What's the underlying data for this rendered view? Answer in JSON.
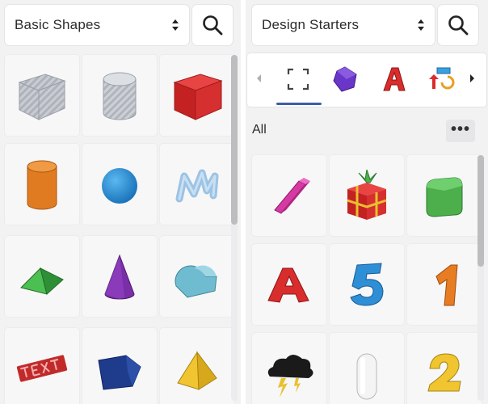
{
  "left_panel": {
    "library_select": {
      "selected": "Basic Shapes"
    },
    "search_icon": "search-icon",
    "shapes": [
      {
        "name": "box-hole",
        "color": "#b8bcc4"
      },
      {
        "name": "cylinder-hole",
        "color": "#b8bcc4"
      },
      {
        "name": "box",
        "color": "#d92d2d"
      },
      {
        "name": "cylinder",
        "color": "#e07b22"
      },
      {
        "name": "sphere",
        "color": "#1e8fd6"
      },
      {
        "name": "scribble",
        "color": "#9cc3e4"
      },
      {
        "name": "roof",
        "color": "#3aa040"
      },
      {
        "name": "cone",
        "color": "#7a2fa8"
      },
      {
        "name": "round-roof",
        "color": "#6fbcd0"
      },
      {
        "name": "text",
        "color": "#c22a2a"
      },
      {
        "name": "polygon",
        "color": "#1f3b8c"
      },
      {
        "name": "pyramid",
        "color": "#f1c530"
      }
    ]
  },
  "right_panel": {
    "library_select": {
      "selected": "Design Starters"
    },
    "search_icon": "search-icon",
    "category_tabs": [
      {
        "name": "all-icon",
        "active": true
      },
      {
        "name": "gem-icon",
        "active": false,
        "color": "#6a35c9"
      },
      {
        "name": "letter-icon",
        "active": false,
        "color": "#d92d2d"
      },
      {
        "name": "transform-icon",
        "active": false,
        "color": "#3aa0e0"
      }
    ],
    "section_title": "All",
    "more_label": "•••",
    "starters": [
      {
        "name": "pink-bar",
        "color": "#d63aa2"
      },
      {
        "name": "gift-box",
        "color": "#d92d2d"
      },
      {
        "name": "rounded-box",
        "color": "#4caf4c"
      },
      {
        "name": "letter-a",
        "color": "#d92d2d"
      },
      {
        "name": "number-5",
        "color": "#2f8fd6"
      },
      {
        "name": "number-1",
        "color": "#e87c22"
      },
      {
        "name": "storm-cloud",
        "color": "#1a1a1a"
      },
      {
        "name": "capsule",
        "color": "#e8e8e8"
      },
      {
        "name": "number-2",
        "color": "#f1c530"
      }
    ]
  }
}
